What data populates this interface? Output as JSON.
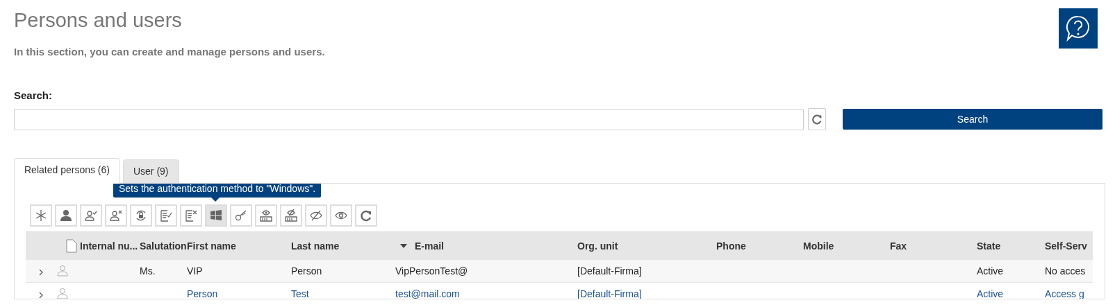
{
  "header": {
    "title": "Persons and users",
    "subtitle": "In this section, you can create and manage persons and users."
  },
  "search": {
    "label": "Search:",
    "button": "Search"
  },
  "tabs": [
    {
      "label": "Related persons (6)",
      "selected": true
    },
    {
      "label": "User (9)",
      "selected": false
    }
  ],
  "tooltip": "Sets the authentication method to \"Windows\".",
  "toolbar": [
    {
      "kind": "asterisk",
      "selected": false
    },
    {
      "kind": "person",
      "selected": false
    },
    {
      "kind": "person-check",
      "selected": false
    },
    {
      "kind": "person-x",
      "selected": false
    },
    {
      "kind": "lock-cycle",
      "selected": false
    },
    {
      "kind": "list-check",
      "selected": false
    },
    {
      "kind": "list-x",
      "selected": false
    },
    {
      "kind": "windows",
      "selected": true
    },
    {
      "kind": "key",
      "selected": false
    },
    {
      "kind": "card-eye",
      "selected": false
    },
    {
      "kind": "card-eye-off",
      "selected": false
    },
    {
      "kind": "eye-off",
      "selected": false
    },
    {
      "kind": "eye",
      "selected": false
    },
    {
      "kind": "refresh",
      "selected": false
    }
  ],
  "table": {
    "columns": [
      {
        "label": "Internal nu...",
        "sorted": false
      },
      {
        "label": "Salutation",
        "sorted": false
      },
      {
        "label": "First name",
        "sorted": false
      },
      {
        "label": "Last name",
        "sorted": false
      },
      {
        "label": "E-mail",
        "sorted": true
      },
      {
        "label": "Org. unit",
        "sorted": false
      },
      {
        "label": "Phone",
        "sorted": false
      },
      {
        "label": "Mobile",
        "sorted": false
      },
      {
        "label": "Fax",
        "sorted": false
      },
      {
        "label": "State",
        "sorted": false
      },
      {
        "label": "Self-Serv",
        "sorted": false
      }
    ],
    "rows": [
      {
        "kind": "plain",
        "cells": [
          "",
          "Ms.",
          "VIP",
          "Person",
          "VipPersonTest@",
          "[Default-Firma]",
          "",
          "",
          "",
          "Active",
          "No acces"
        ]
      },
      {
        "kind": "link",
        "cells": [
          "",
          "",
          "Person",
          "Test",
          "test@mail.com",
          "[Default-Firma]",
          "",
          "",
          "",
          "Active",
          "Access g"
        ]
      }
    ]
  }
}
